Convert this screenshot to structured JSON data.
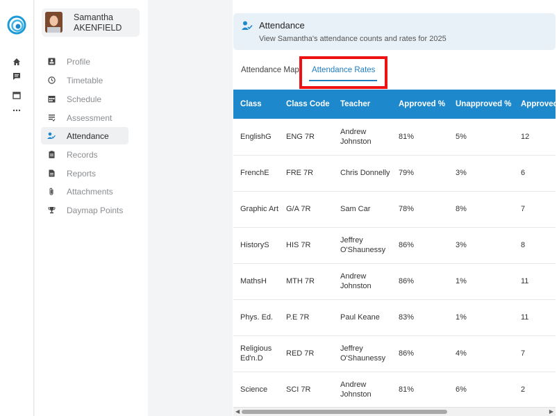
{
  "rail": {
    "icons": [
      "swirl-logo-icon",
      "home-icon",
      "message-icon",
      "calendar-icon",
      "more-icon"
    ]
  },
  "profile": {
    "first_name": "Samantha",
    "last_name": "AKENFIELD"
  },
  "nav": {
    "items": [
      {
        "label": "Profile",
        "icon": "id-card-icon"
      },
      {
        "label": "Timetable",
        "icon": "clock-icon"
      },
      {
        "label": "Schedule",
        "icon": "calendar-grid-icon"
      },
      {
        "label": "Assessment",
        "icon": "checklist-icon"
      },
      {
        "label": "Attendance",
        "icon": "person-check-icon",
        "active": true
      },
      {
        "label": "Records",
        "icon": "clipboard-icon"
      },
      {
        "label": "Reports",
        "icon": "document-icon"
      },
      {
        "label": "Attachments",
        "icon": "paperclip-icon"
      },
      {
        "label": "Daymap Points",
        "icon": "trophy-icon"
      }
    ]
  },
  "banner": {
    "title": "Attendance",
    "subtitle": "View Samantha's attendance counts and rates for 2025"
  },
  "tabs": {
    "map": "Attendance Map",
    "rates": "Attendance Rates",
    "active": "rates"
  },
  "table": {
    "headers": [
      "Class",
      "Class Code",
      "Teacher",
      "Approved %",
      "Unapproved %",
      "Approved"
    ],
    "rows": [
      [
        "EnglishG",
        "ENG 7R",
        "Andrew Johnston",
        "81%",
        "5%",
        "12"
      ],
      [
        "FrenchE",
        "FRE 7R",
        "Chris Donnelly",
        "79%",
        "3%",
        "6"
      ],
      [
        "Graphic Art",
        "G/A 7R",
        "Sam Car",
        "78%",
        "8%",
        "7"
      ],
      [
        "HistoryS",
        "HIS 7R",
        "Jeffrey O'Shaunessy",
        "86%",
        "3%",
        "8"
      ],
      [
        "MathsH",
        "MTH 7R",
        "Andrew Johnston",
        "86%",
        "1%",
        "11"
      ],
      [
        "Phys. Ed.",
        "P.E 7R",
        "Paul Keane",
        "83%",
        "1%",
        "11"
      ],
      [
        "Religious Ed'n.D",
        "RED 7R",
        "Jeffrey O'Shaunessy",
        "86%",
        "4%",
        "7"
      ],
      [
        "Science",
        "SCI 7R",
        "Andrew Johnston",
        "81%",
        "6%",
        "2"
      ]
    ]
  },
  "colors": {
    "accent": "#1e88cd",
    "banner_bg": "#e8f1f8",
    "highlight": "#ee1111"
  }
}
